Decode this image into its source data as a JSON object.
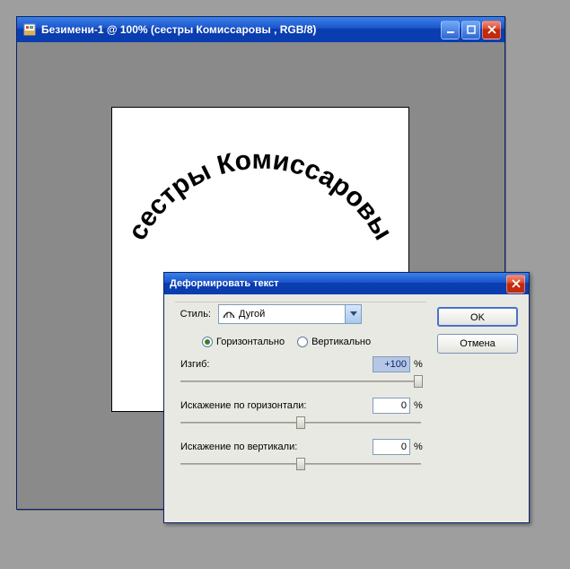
{
  "main_window": {
    "title": "Безимени-1 @ 100% (сестры Комиссаровы , RGB/8)",
    "canvas_text": "сестры Комиссаровы"
  },
  "dialog": {
    "title": "Деформировать текст",
    "style_label": "Стиль:",
    "style_value": "Дугой",
    "orient": {
      "horizontal": "Горизонтально",
      "vertical": "Вертикально",
      "selected": "horizontal"
    },
    "bend": {
      "label": "Изгиб:",
      "value": "+100",
      "unit": "%"
    },
    "hdist": {
      "label": "Искажение по горизонтали:",
      "value": "0",
      "unit": "%"
    },
    "vdist": {
      "label": "Искажение по вертикали:",
      "value": "0",
      "unit": "%"
    },
    "ok": "OK",
    "cancel": "Отмена"
  }
}
